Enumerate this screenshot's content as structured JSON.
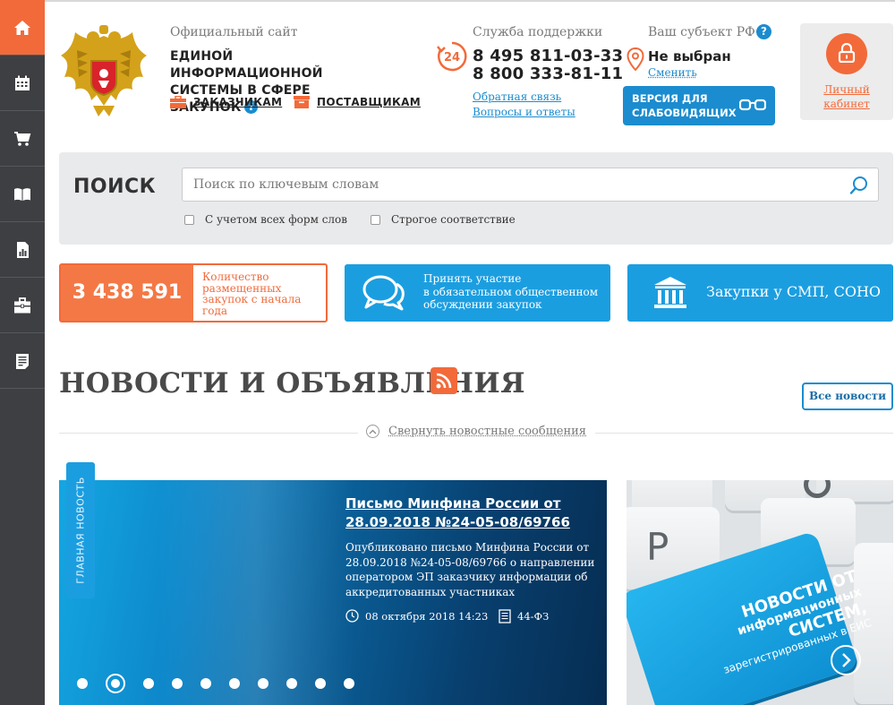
{
  "sidebar": {
    "items": [
      {
        "icon": "home-icon",
        "active": true
      },
      {
        "icon": "calendar-icon",
        "active": false
      },
      {
        "icon": "cart-icon",
        "active": false
      },
      {
        "icon": "book-icon",
        "active": false
      },
      {
        "icon": "report-icon",
        "active": false
      },
      {
        "icon": "briefcase-icon",
        "active": false
      },
      {
        "icon": "document-icon",
        "active": false
      }
    ]
  },
  "header": {
    "subtitle": "Официальный сайт",
    "title_line1": "ЕДИНОЙ ИНФОРМАЦИОННОЙ",
    "title_line2": "СИСТЕМЫ В СФЕРЕ ЗАКУПОК",
    "info_glyph": "i",
    "link_customers": "ЗАКАЗЧИКАМ",
    "link_suppliers": "ПОСТАВЩИКАМ"
  },
  "support": {
    "title": "Служба поддержки",
    "badge": "24",
    "phone1": "8 495 811-03-33",
    "phone2": "8 800 333-81-11",
    "feedback": "Обратная связь",
    "faq": "Вопросы и ответы"
  },
  "region": {
    "title": "Ваш субъект РФ",
    "help": "?",
    "value": "Не выбран",
    "change": "Сменить"
  },
  "vision_button": {
    "line1": "ВЕРСИЯ ДЛЯ",
    "line2": "СЛАБОВИДЯЩИХ"
  },
  "cabinet": {
    "line1": "Личный",
    "line2": "кабинет"
  },
  "search": {
    "label": "ПОИСК",
    "placeholder": "Поиск по ключевым словам",
    "option1": "С учетом всех форм слов",
    "option2": "Строгое соответствие"
  },
  "tiles": {
    "count_value": "3 438 591",
    "count_desc": "Количество размещенных закупок с начала года",
    "discussion": [
      "Принять участие",
      "в обязательном общественном",
      "обсуждении закупок"
    ],
    "smp": "Закупки у СМП, СОНО"
  },
  "news": {
    "heading": "НОВОСТИ И ОБЪЯВЛЕНИЯ",
    "all_news": "Все новости",
    "collapse": "Свернуть новостные сообщения",
    "badge": "ГЛАВНАЯ НОВОСТЬ",
    "headline": "Письмо Минфина России от 28.09.2018 №24-05-08/69766",
    "body": "Опубликовано письмо Минфина России от 28.09.2018 №24-05-08/69766 о направлении оператором ЭП заказчику информации об аккредитованных участниках",
    "date": "08 октября 2018 14:23",
    "law": "44-ФЗ",
    "slides_total": 10,
    "slide_active": 2
  },
  "banner": {
    "key_letter": "P",
    "line1": "НОВОСТИ ОТ",
    "line2": "информационных",
    "line3": "СИСТЕМ,",
    "line4": "зарегистрированных в ЕИС"
  },
  "colors": {
    "accent": "#f26a3a",
    "brand_blue": "#1b8ccf",
    "tile_blue": "#1b9ee0",
    "sidebar": "#3d3f42"
  }
}
